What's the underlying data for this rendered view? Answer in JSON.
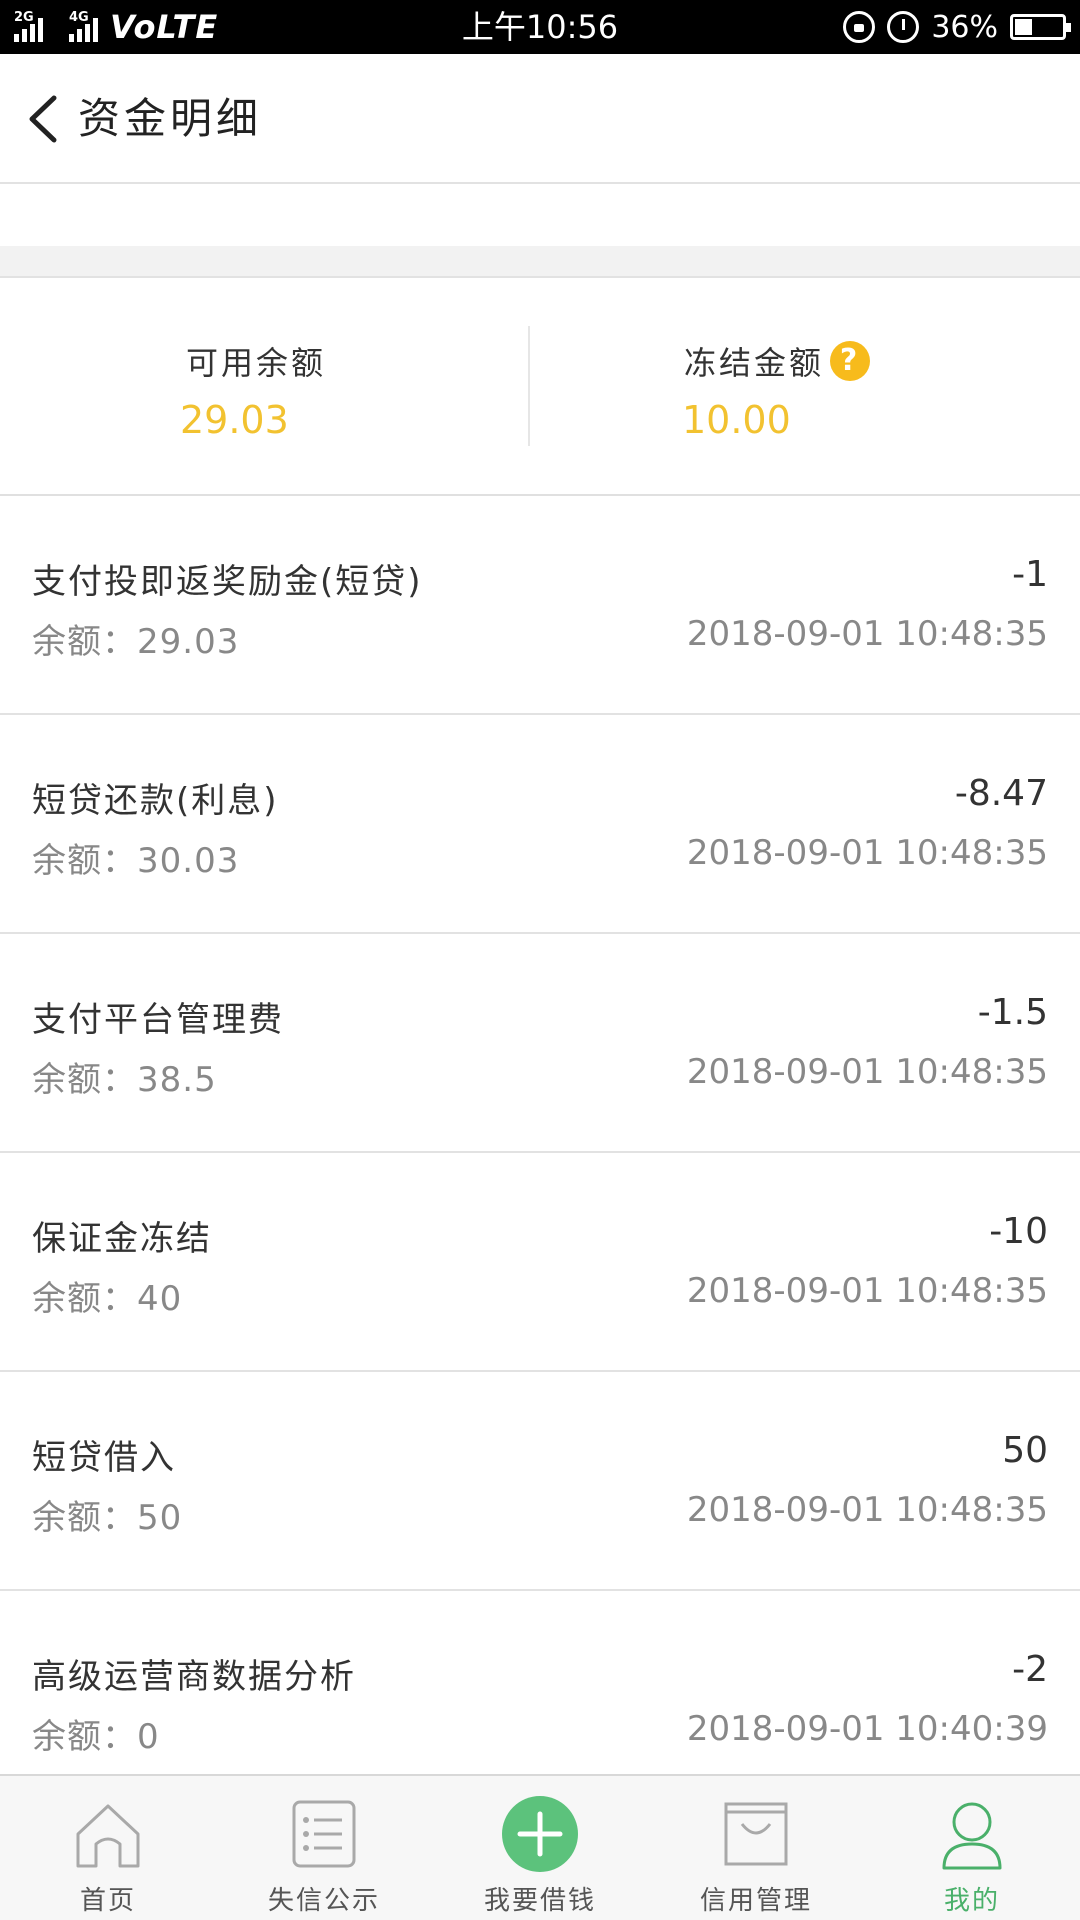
{
  "status_bar": {
    "net1": "2G",
    "net2": "4G",
    "carrier": "VoLTE",
    "time": "上午10:56",
    "battery_text": "36%",
    "battery_level": 0.36
  },
  "header": {
    "title": "资金明细"
  },
  "summary": {
    "available_label": "可用余额",
    "available_value": "29.03",
    "frozen_label": "冻结金额",
    "frozen_value": "10.00",
    "help_glyph": "?",
    "value_color": "#f2c230"
  },
  "transactions": [
    {
      "title": "支付投即返奖励金(短贷)",
      "amount": "-1",
      "balance": "余额：29.03",
      "time": "2018-09-01 10:48:35"
    },
    {
      "title": "短贷还款(利息)",
      "amount": "-8.47",
      "balance": "余额：30.03",
      "time": "2018-09-01 10:48:35"
    },
    {
      "title": "支付平台管理费",
      "amount": "-1.5",
      "balance": "余额：38.5",
      "time": "2018-09-01 10:48:35"
    },
    {
      "title": "保证金冻结",
      "amount": "-10",
      "balance": "余额：40",
      "time": "2018-09-01 10:48:35"
    },
    {
      "title": "短贷借入",
      "amount": "50",
      "balance": "余额：50",
      "time": "2018-09-01 10:48:35"
    },
    {
      "title": "高级运营商数据分析",
      "amount": "-2",
      "balance": "余额：0",
      "time": "2018-09-01 10:40:39"
    }
  ],
  "nav": {
    "home": "首页",
    "discredit": "失信公示",
    "borrow": "我要借钱",
    "credit": "信用管理",
    "mine": "我的",
    "accent_color": "#4ab06a"
  }
}
